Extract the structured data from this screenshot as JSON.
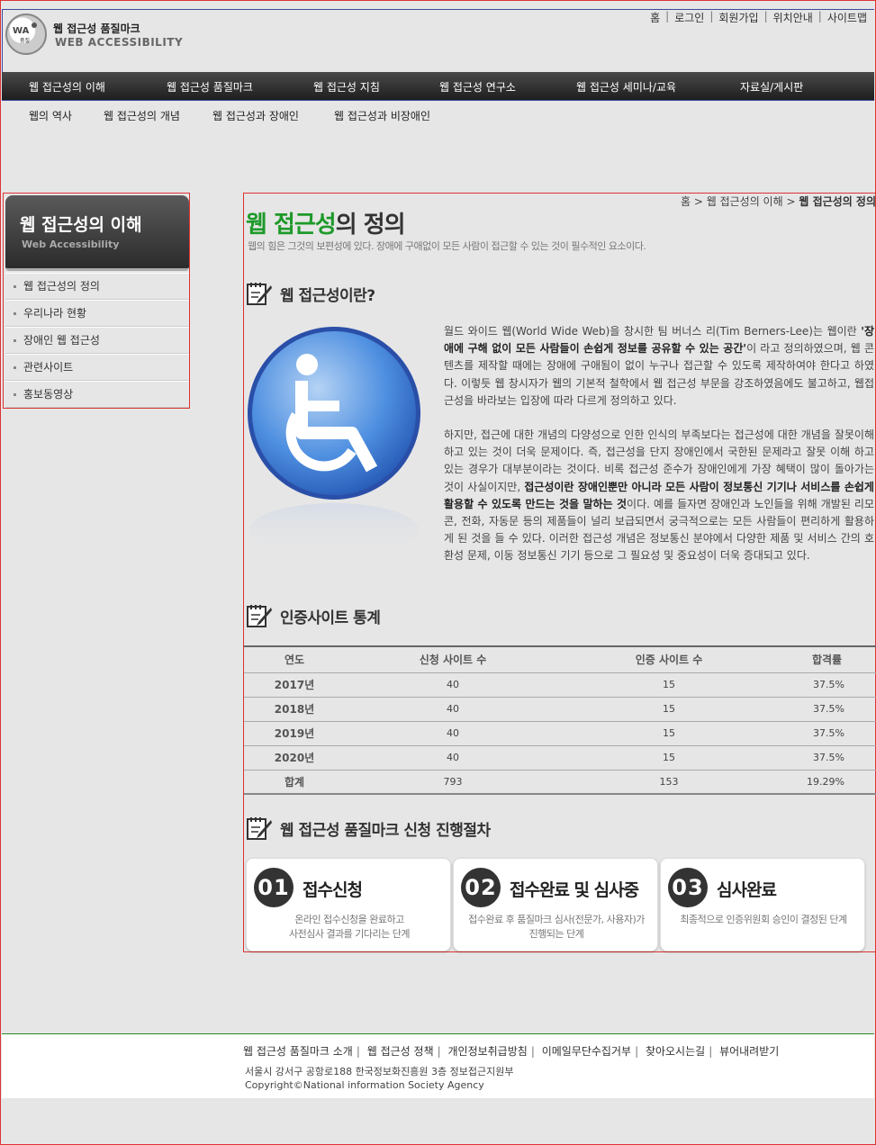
{
  "header": {
    "logo_title": "웹 접근성 품질마크",
    "logo_sub": "WEB ACCESSIBILITY",
    "util_links": [
      "홈",
      "로그인",
      "회원가입",
      "위치안내",
      "사이트맵"
    ]
  },
  "gnb": [
    "웹 접근성의 이해",
    "웹 접근성 품질마크",
    "웹 접근성 지침",
    "웹 접근성 연구소",
    "웹 접근성 세미나/교육",
    "자료실/게시판"
  ],
  "lnb": [
    "웹의 역사",
    "웹 접근성의 개념",
    "웹 접근성과 장애인",
    "웹 접근성과 비장애인"
  ],
  "sidebar": {
    "title": "웹 접근성의 이해",
    "subtitle": "Web Accessibility",
    "items": [
      "웹 접근성의 정의",
      "우리나라 현황",
      "장애인 웹 접근성",
      "관련사이트",
      "홍보동영상"
    ]
  },
  "breadcrumb": {
    "home": "홈",
    "sep": ">",
    "level1": "웹 접근성의 이해",
    "current": "웹 접근성의 정의"
  },
  "page": {
    "title_green": "웹 접근성",
    "title_rest": "의 정의",
    "desc": "웹의 힘은 그것의 보편성에 있다. 장애에 구애없이 모든 사람이 접근할 수 있는 것이 필수적인 요소이다."
  },
  "section1": {
    "title": "웹 접근성이란?",
    "p1_a": "월드 와이드 웹(World Wide Web)을 창시한 팀 버너스 리(Tim Berners-Lee)는 웹이란 ",
    "p1_b": "'장애에 구해 없이 모든 사람들이 손쉽게 정보를 공유할 수 있는 공간'",
    "p1_c": "이 라고 정의하였으며, 웹 콘텐츠를 제작할 때에는 장애에 구애됨이 없이 누구나 접근할 수 있도록 제작하여야 한다고 하였다. 이렇듯 웹 창시자가 웹의 기본적 철학에서 웹 접근성 부문을 강조하였음에도 불고하고, 웹접근성을 바라보는 입장에 따라 다르게 정의하고 있다.",
    "p2_a": "하지만, 접근에 대한 개념의 다양성으로 인한 인식의 부족보다는 접근성에 대한 개념을 잘못이해하고 있는 것이 더욱 문제이다. 즉, 접근성을 단지 장애인에서 국한된 문제라고 잘못 이해 하고 있는 경우가 대부분이라는 것이다. 비록 접근성 준수가 장애인에게 가장 혜택이 많이 돌아가는 것이 사실이지만, ",
    "p2_b": "접근성이란 장애인뿐만 아니라 모든 사람이 정보통신 기기나 서비스를 손쉽게 활용할 수 있도록 만드는 것을 말하는 것",
    "p2_c": "이다. 예를 들자면 장애인과 노인들을 위해 개발된 리모콘, 전화, 자동문 등의 제품들이 널리 보급되면서 궁극적으로는 모든 사람들이 편리하게 활용하게 된 것을 들 수 있다. 이러한 접근성 개념은 정보통신 분야에서 다양한 제품 및 서비스 간의 호환성 문제, 이동 정보통신 기기 등으로 그 필요성 및 중요성이 더욱 증대되고 있다."
  },
  "section2": {
    "title": "인증사이트 통계",
    "headers": [
      "연도",
      "신청 사이트 수",
      "인증 사이트 수",
      "합격률"
    ],
    "rows": [
      [
        "2017년",
        "40",
        "15",
        "37.5%"
      ],
      [
        "2018년",
        "40",
        "15",
        "37.5%"
      ],
      [
        "2019년",
        "40",
        "15",
        "37.5%"
      ],
      [
        "2020년",
        "40",
        "15",
        "37.5%"
      ],
      [
        "합계",
        "793",
        "153",
        "19.29%"
      ]
    ]
  },
  "section3": {
    "title": "웹 접근성 품질마크 신청 진행절차",
    "steps": [
      {
        "num": "01",
        "title": "접수신청",
        "desc1": "온라인 접수신청을 완료하고",
        "desc2": "사전심사 결과를 기다리는 단계"
      },
      {
        "num": "02",
        "title": "접수완료 및 심사중",
        "desc1": "접수완료 후 품질마크 심사(전문가, 사용자)가",
        "desc2": "진행되는 단계"
      },
      {
        "num": "03",
        "title": "심사완료",
        "desc1": "최종적으로 인증위원회 승인이 결정된 단계",
        "desc2": ""
      }
    ]
  },
  "footer": {
    "links": [
      "웹 접근성 품질마크 소개",
      "웹 접근성 정책",
      "개인정보취급방침",
      "이메일무단수집거부",
      "찾아오시는길",
      "뷰어내려받기"
    ],
    "address": "서울시 강서구 공항로188 한국정보화진흥원 3층 정보접근지원부",
    "copyright": "Copyright©National information Society Agency"
  },
  "colors": {
    "accent_green": "#1e9a2a",
    "nav_dark": "#2b2b2b",
    "frame_red": "#dd3333"
  }
}
